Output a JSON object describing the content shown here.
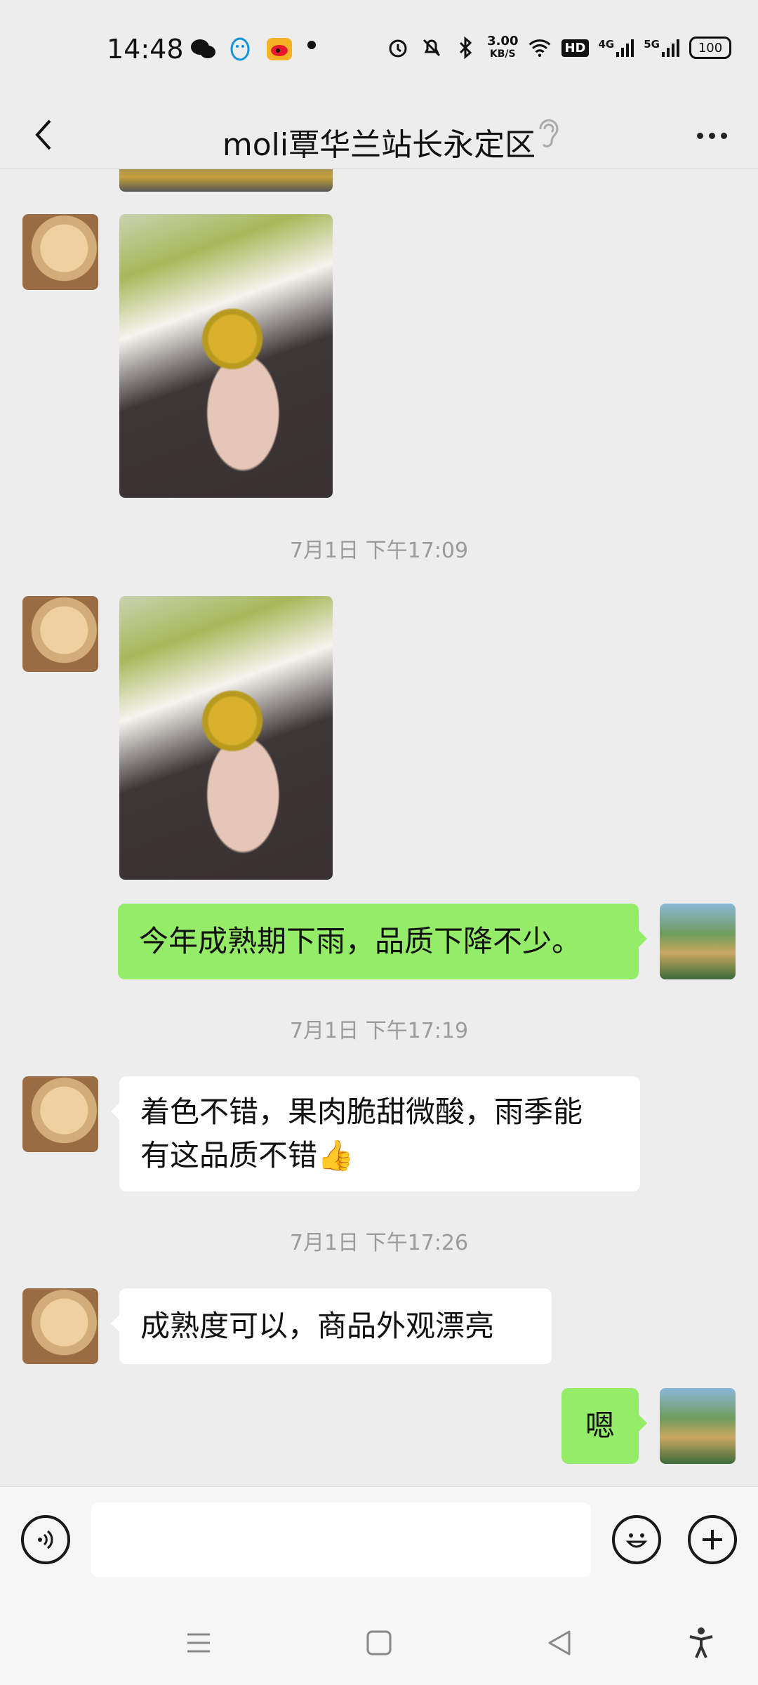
{
  "status_bar": {
    "time": "14:48",
    "apps": [
      {
        "name": "wechat",
        "color": "#07c160"
      },
      {
        "name": "qq",
        "color": "#1296db"
      },
      {
        "name": "weibo",
        "color": "#e6162d"
      }
    ],
    "speed_value": "3.00",
    "speed_unit": "KB/S",
    "hd": "HD",
    "net1": "4G",
    "net2": "5G",
    "battery": "100"
  },
  "header": {
    "title": "moli覃华兰站长永定区"
  },
  "messages": {
    "timestamp1": "7月1日 下午17:09",
    "timestamp2": "7月1日 下午17:19",
    "timestamp3": "7月1日 下午17:26",
    "me1": "今年成熟期下雨，品质下降不少。",
    "them1_line1": "着色不错，果肉脆甜微酸，雨季能",
    "them1_line2": "有这品质不错",
    "them1_emoji": "👍",
    "them2": "成熟度可以，商品外观漂亮",
    "me2": "嗯"
  },
  "colors": {
    "chat_bg": "#ededed",
    "bubble_self": "#95ec69",
    "bubble_other": "#ffffff",
    "timestamp": "#9b9b9b"
  }
}
